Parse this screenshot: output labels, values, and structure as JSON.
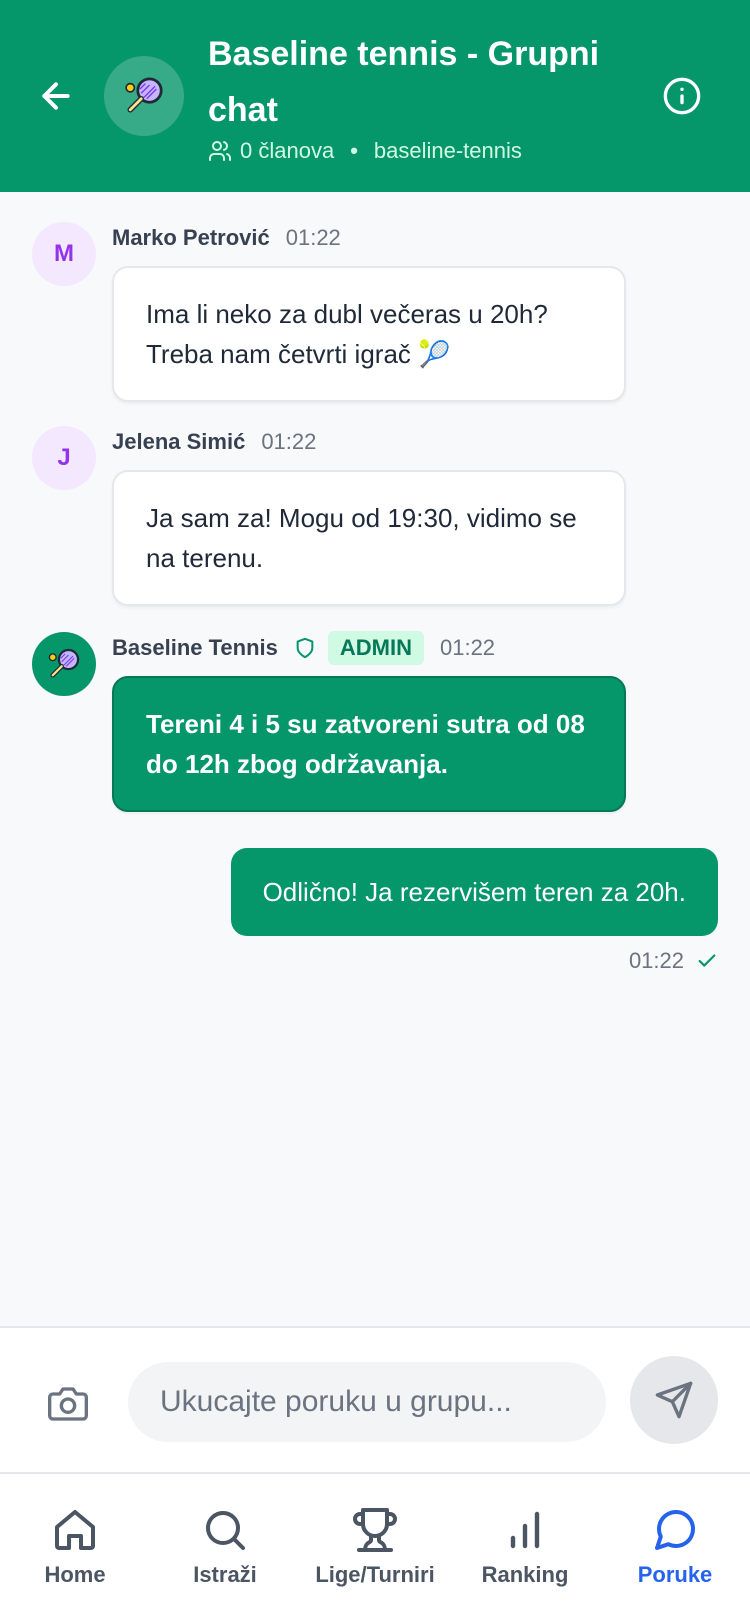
{
  "header": {
    "title": "Baseline tennis - Grupni chat",
    "members": "0 članova",
    "slug": "baseline-tennis"
  },
  "messages": [
    {
      "author": "Marko Petrović",
      "initial": "M",
      "time": "01:22",
      "text": "Ima li neko za dubl večeras u 20h? Treba nam četvrti igrač 🎾"
    },
    {
      "author": "Jelena Simić",
      "initial": "J",
      "time": "01:22",
      "text": "Ja sam za! Mogu od 19:30, vidimo se na terenu."
    },
    {
      "author": "Baseline Tennis",
      "badge": "ADMIN",
      "time": "01:22",
      "text": "Tereni 4 i 5 su zatvoreni sutra od 08 do 12h zbog održavanja."
    }
  ],
  "own_message": {
    "text": "Odlično! Ja rezervišem teren za 20h.",
    "time": "01:22"
  },
  "composer": {
    "placeholder": "Ukucajte poruku u grupu..."
  },
  "nav": [
    {
      "label": "Home",
      "icon": "home-icon"
    },
    {
      "label": "Istraži",
      "icon": "search-icon"
    },
    {
      "label": "Lige/Turniri",
      "icon": "trophy-icon"
    },
    {
      "label": "Ranking",
      "icon": "bar-chart-icon"
    },
    {
      "label": "Poruke",
      "icon": "chat-icon",
      "active": true
    }
  ],
  "colors": {
    "brand": "#059669",
    "active_nav": "#2563eb",
    "admin_badge_bg": "#d1fae5"
  }
}
